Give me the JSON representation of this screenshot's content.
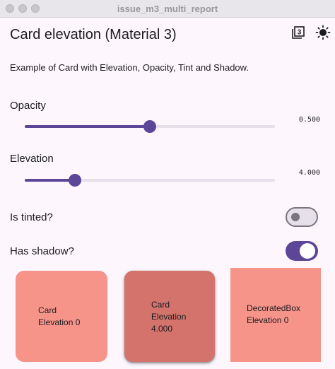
{
  "window": {
    "title": "issue_m3_multi_report"
  },
  "app": {
    "title": "Card elevation (Material 3)",
    "description": "Example of Card with Elevation, Opacity, Tint and Shadow.",
    "actions": [
      "material3-icon",
      "brightness-icon"
    ]
  },
  "opacity": {
    "label": "Opacity",
    "value_text": "0.500",
    "value": 0.5,
    "min": 0,
    "max": 1
  },
  "elevation": {
    "label": "Elevation",
    "value_text": "4.000",
    "value": 4.0,
    "min": 0,
    "max": 20
  },
  "tinted": {
    "label": "Is tinted?",
    "on": false
  },
  "shadow": {
    "label": "Has shadow?",
    "on": true
  },
  "cards": [
    {
      "line1": "Card",
      "line2": "Elevation 0",
      "line3": "",
      "color": "#f7948a"
    },
    {
      "line1": "Card",
      "line2": "Elevation",
      "line3": "4.000",
      "color": "#d3736b"
    },
    {
      "line1": "DecoratedBox",
      "line2": "Elevation 0",
      "line3": "",
      "color": "#f7948a"
    }
  ],
  "colors": {
    "accent": "#5b4698",
    "background": "#fdf7fd",
    "card": "#f7948a"
  }
}
